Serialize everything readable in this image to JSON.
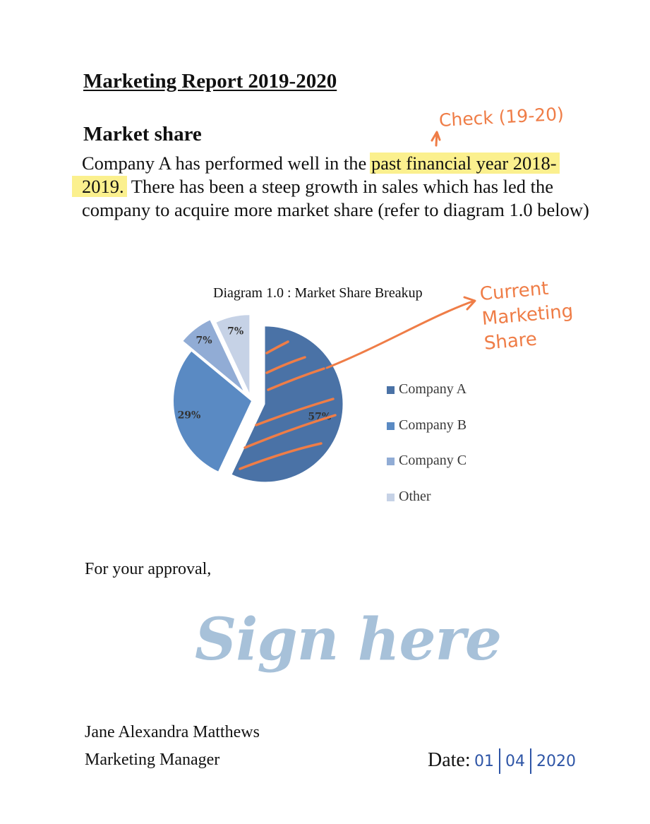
{
  "document": {
    "title": "Marketing Report 2019-2020",
    "section_heading": "Market share",
    "paragraph": {
      "part1": "Company A has performed well in the ",
      "highlight_line1": "past financial year 2018-",
      "highlight_line2": "2019.",
      "part2": " There has been a steep growth in sales which has led the company to acquire more market share (refer to diagram 1.0 below)"
    },
    "closing": "For your approval,",
    "signature_text": "Sign here",
    "signer_name": "Jane Alexandra Matthews",
    "signer_role": "Marketing Manager",
    "date_label": "Date:",
    "date_parts": [
      "01",
      "04",
      "2020"
    ]
  },
  "annotations": {
    "check_note": "Check (19-20)",
    "chart_note_lines": [
      "Current",
      "Marketing",
      "Share"
    ],
    "ink_color": "#ef7d47",
    "highlight_color": "#fbf08e",
    "date_ink_color": "#2e55a6"
  },
  "chart_data": {
    "type": "pie",
    "title": "Diagram 1.0 : Market Share Breakup",
    "exploded": true,
    "slices": [
      {
        "name": "Company A",
        "value": 57,
        "label": "57%",
        "color": "#4a72a6"
      },
      {
        "name": "Company B",
        "value": 29,
        "label": "29%",
        "color": "#5a8ac3"
      },
      {
        "name": "Company C",
        "value": 7,
        "label": "7%",
        "color": "#91acd5"
      },
      {
        "name": "Other",
        "value": 7,
        "label": "7%",
        "color": "#c6d2e6"
      }
    ]
  }
}
